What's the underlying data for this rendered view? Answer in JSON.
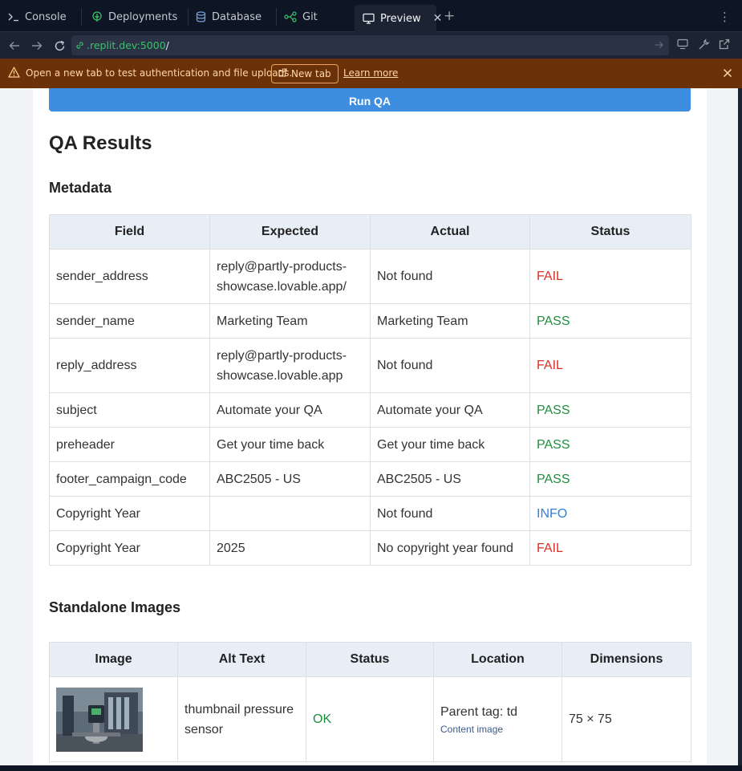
{
  "tabs": [
    {
      "label": "Console",
      "icon": "terminal-icon"
    },
    {
      "label": "Deployments",
      "icon": "deploy-icon"
    },
    {
      "label": "Database",
      "icon": "database-icon"
    },
    {
      "label": "Git",
      "icon": "git-icon"
    },
    {
      "label": "Preview",
      "icon": "monitor-icon",
      "active": true
    }
  ],
  "add_tab_label": "+",
  "url": {
    "host": ".replit.dev:5000",
    "path": "/"
  },
  "banner": {
    "message": "Open a new tab to test authentication and file uploads.",
    "new_tab_label": "New tab",
    "learn_more_label": "Learn more"
  },
  "app": {
    "run_button": "Run QA",
    "results_title": "QA Results",
    "metadata_title": "Metadata",
    "metadata_headers": [
      "Field",
      "Expected",
      "Actual",
      "Status"
    ],
    "metadata_rows": [
      {
        "field": "sender_address",
        "expected": "reply@partly-products-showcase.lovable.app/",
        "actual": "Not found",
        "status": "FAIL"
      },
      {
        "field": "sender_name",
        "expected": "Marketing Team",
        "actual": "Marketing Team",
        "status": "PASS"
      },
      {
        "field": "reply_address",
        "expected": "reply@partly-products-showcase.lovable.app",
        "actual": "Not found",
        "status": "FAIL"
      },
      {
        "field": "subject",
        "expected": "Automate your QA",
        "actual": "Automate your QA",
        "status": "PASS"
      },
      {
        "field": "preheader",
        "expected": "Get your time back",
        "actual": "Get your time back",
        "status": "PASS"
      },
      {
        "field": "footer_campaign_code",
        "expected": "ABC2505 - US",
        "actual": "ABC2505 - US",
        "status": "PASS"
      },
      {
        "field": "Copyright Year",
        "expected": "",
        "actual": "Not found",
        "status": "INFO"
      },
      {
        "field": "Copyright Year",
        "expected": "2025",
        "actual": "No copyright year found",
        "status": "FAIL"
      }
    ],
    "images_title": "Standalone Images",
    "images_headers": [
      "Image",
      "Alt Text",
      "Status",
      "Location",
      "Dimensions"
    ],
    "images_rows": [
      {
        "alt": "thumbnail pressure sensor",
        "status": "OK",
        "location": "Parent tag: td",
        "location_note": "Content image",
        "dimensions": "75 × 75"
      }
    ]
  },
  "colors": {
    "fail": "#d93025",
    "pass": "#1e8e3e",
    "info": "#2f80d1",
    "accent": "#3d8de0"
  }
}
